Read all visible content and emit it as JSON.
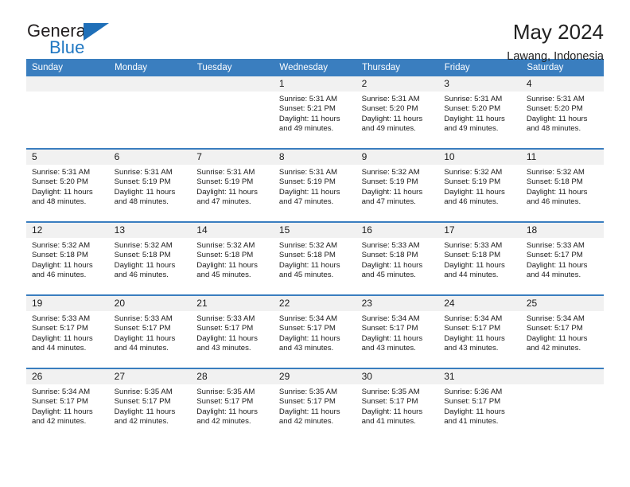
{
  "brand": {
    "name_part1": "General",
    "name_part2": "Blue",
    "triangle_color": "#1f6fb8",
    "accent_color": "#3a7ebf"
  },
  "header": {
    "title": "May 2024",
    "subtitle": "Lawang, Indonesia"
  },
  "weekday_headers": [
    "Sunday",
    "Monday",
    "Tuesday",
    "Wednesday",
    "Thursday",
    "Friday",
    "Saturday"
  ],
  "weeks": [
    [
      {
        "day": "",
        "lines": []
      },
      {
        "day": "",
        "lines": []
      },
      {
        "day": "",
        "lines": []
      },
      {
        "day": "1",
        "lines": [
          "Sunrise: 5:31 AM",
          "Sunset: 5:21 PM",
          "Daylight: 11 hours",
          "and 49 minutes."
        ]
      },
      {
        "day": "2",
        "lines": [
          "Sunrise: 5:31 AM",
          "Sunset: 5:20 PM",
          "Daylight: 11 hours",
          "and 49 minutes."
        ]
      },
      {
        "day": "3",
        "lines": [
          "Sunrise: 5:31 AM",
          "Sunset: 5:20 PM",
          "Daylight: 11 hours",
          "and 49 minutes."
        ]
      },
      {
        "day": "4",
        "lines": [
          "Sunrise: 5:31 AM",
          "Sunset: 5:20 PM",
          "Daylight: 11 hours",
          "and 48 minutes."
        ]
      }
    ],
    [
      {
        "day": "5",
        "lines": [
          "Sunrise: 5:31 AM",
          "Sunset: 5:20 PM",
          "Daylight: 11 hours",
          "and 48 minutes."
        ]
      },
      {
        "day": "6",
        "lines": [
          "Sunrise: 5:31 AM",
          "Sunset: 5:19 PM",
          "Daylight: 11 hours",
          "and 48 minutes."
        ]
      },
      {
        "day": "7",
        "lines": [
          "Sunrise: 5:31 AM",
          "Sunset: 5:19 PM",
          "Daylight: 11 hours",
          "and 47 minutes."
        ]
      },
      {
        "day": "8",
        "lines": [
          "Sunrise: 5:31 AM",
          "Sunset: 5:19 PM",
          "Daylight: 11 hours",
          "and 47 minutes."
        ]
      },
      {
        "day": "9",
        "lines": [
          "Sunrise: 5:32 AM",
          "Sunset: 5:19 PM",
          "Daylight: 11 hours",
          "and 47 minutes."
        ]
      },
      {
        "day": "10",
        "lines": [
          "Sunrise: 5:32 AM",
          "Sunset: 5:19 PM",
          "Daylight: 11 hours",
          "and 46 minutes."
        ]
      },
      {
        "day": "11",
        "lines": [
          "Sunrise: 5:32 AM",
          "Sunset: 5:18 PM",
          "Daylight: 11 hours",
          "and 46 minutes."
        ]
      }
    ],
    [
      {
        "day": "12",
        "lines": [
          "Sunrise: 5:32 AM",
          "Sunset: 5:18 PM",
          "Daylight: 11 hours",
          "and 46 minutes."
        ]
      },
      {
        "day": "13",
        "lines": [
          "Sunrise: 5:32 AM",
          "Sunset: 5:18 PM",
          "Daylight: 11 hours",
          "and 46 minutes."
        ]
      },
      {
        "day": "14",
        "lines": [
          "Sunrise: 5:32 AM",
          "Sunset: 5:18 PM",
          "Daylight: 11 hours",
          "and 45 minutes."
        ]
      },
      {
        "day": "15",
        "lines": [
          "Sunrise: 5:32 AM",
          "Sunset: 5:18 PM",
          "Daylight: 11 hours",
          "and 45 minutes."
        ]
      },
      {
        "day": "16",
        "lines": [
          "Sunrise: 5:33 AM",
          "Sunset: 5:18 PM",
          "Daylight: 11 hours",
          "and 45 minutes."
        ]
      },
      {
        "day": "17",
        "lines": [
          "Sunrise: 5:33 AM",
          "Sunset: 5:18 PM",
          "Daylight: 11 hours",
          "and 44 minutes."
        ]
      },
      {
        "day": "18",
        "lines": [
          "Sunrise: 5:33 AM",
          "Sunset: 5:17 PM",
          "Daylight: 11 hours",
          "and 44 minutes."
        ]
      }
    ],
    [
      {
        "day": "19",
        "lines": [
          "Sunrise: 5:33 AM",
          "Sunset: 5:17 PM",
          "Daylight: 11 hours",
          "and 44 minutes."
        ]
      },
      {
        "day": "20",
        "lines": [
          "Sunrise: 5:33 AM",
          "Sunset: 5:17 PM",
          "Daylight: 11 hours",
          "and 44 minutes."
        ]
      },
      {
        "day": "21",
        "lines": [
          "Sunrise: 5:33 AM",
          "Sunset: 5:17 PM",
          "Daylight: 11 hours",
          "and 43 minutes."
        ]
      },
      {
        "day": "22",
        "lines": [
          "Sunrise: 5:34 AM",
          "Sunset: 5:17 PM",
          "Daylight: 11 hours",
          "and 43 minutes."
        ]
      },
      {
        "day": "23",
        "lines": [
          "Sunrise: 5:34 AM",
          "Sunset: 5:17 PM",
          "Daylight: 11 hours",
          "and 43 minutes."
        ]
      },
      {
        "day": "24",
        "lines": [
          "Sunrise: 5:34 AM",
          "Sunset: 5:17 PM",
          "Daylight: 11 hours",
          "and 43 minutes."
        ]
      },
      {
        "day": "25",
        "lines": [
          "Sunrise: 5:34 AM",
          "Sunset: 5:17 PM",
          "Daylight: 11 hours",
          "and 42 minutes."
        ]
      }
    ],
    [
      {
        "day": "26",
        "lines": [
          "Sunrise: 5:34 AM",
          "Sunset: 5:17 PM",
          "Daylight: 11 hours",
          "and 42 minutes."
        ]
      },
      {
        "day": "27",
        "lines": [
          "Sunrise: 5:35 AM",
          "Sunset: 5:17 PM",
          "Daylight: 11 hours",
          "and 42 minutes."
        ]
      },
      {
        "day": "28",
        "lines": [
          "Sunrise: 5:35 AM",
          "Sunset: 5:17 PM",
          "Daylight: 11 hours",
          "and 42 minutes."
        ]
      },
      {
        "day": "29",
        "lines": [
          "Sunrise: 5:35 AM",
          "Sunset: 5:17 PM",
          "Daylight: 11 hours",
          "and 42 minutes."
        ]
      },
      {
        "day": "30",
        "lines": [
          "Sunrise: 5:35 AM",
          "Sunset: 5:17 PM",
          "Daylight: 11 hours",
          "and 41 minutes."
        ]
      },
      {
        "day": "31",
        "lines": [
          "Sunrise: 5:36 AM",
          "Sunset: 5:17 PM",
          "Daylight: 11 hours",
          "and 41 minutes."
        ]
      },
      {
        "day": "",
        "lines": []
      }
    ]
  ]
}
